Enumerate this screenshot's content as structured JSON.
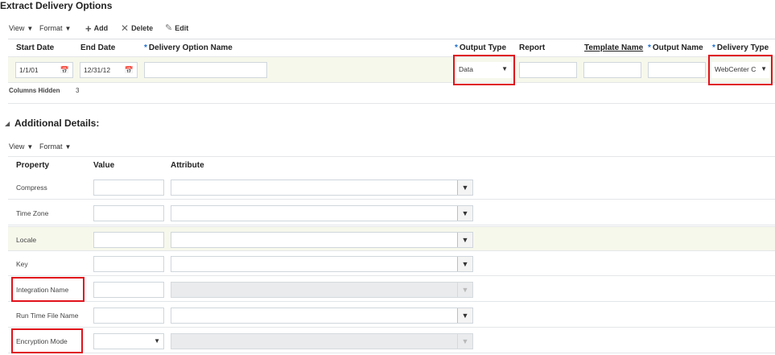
{
  "page_title": "Extract Delivery Options",
  "toolbar": {
    "view": "View",
    "format": "Format",
    "add": "Add",
    "delete": "Delete",
    "edit": "Edit"
  },
  "delivery_table": {
    "headers": {
      "start_date": "Start Date",
      "end_date": "End Date",
      "delivery_option_name": "Delivery Option Name",
      "output_type": "Output Type",
      "report": "Report",
      "template_name": "Template Name",
      "output_name": "Output Name",
      "delivery_type": "Delivery Type"
    },
    "row": {
      "start_date": "1/1/01",
      "end_date": "12/31/12",
      "delivery_option_name": "",
      "output_type": "Data",
      "report": "",
      "template_name": "",
      "output_name": "",
      "delivery_type": "WebCenter C"
    },
    "columns_hidden_label": "Columns Hidden",
    "columns_hidden_count": "3"
  },
  "additional_details": {
    "title": "Additional Details:",
    "toolbar": {
      "view": "View",
      "format": "Format"
    },
    "headers": {
      "property": "Property",
      "value": "Value",
      "attribute": "Attribute"
    },
    "rows": [
      {
        "property": "Compress",
        "value": "",
        "attribute": ""
      },
      {
        "property": "Time Zone",
        "value": "",
        "attribute": ""
      },
      {
        "property": "Locale",
        "value": "",
        "attribute": ""
      },
      {
        "property": "Key",
        "value": "",
        "attribute": ""
      },
      {
        "property": "Integration Name",
        "value": "",
        "attribute": ""
      },
      {
        "property": "Run Time File Name",
        "value": "",
        "attribute": ""
      },
      {
        "property": "Encryption Mode",
        "value": "",
        "attribute": ""
      }
    ]
  },
  "colors": {
    "highlight": "#e0121b",
    "selected_row": "#f7f8ec",
    "required": "#1a6ccf"
  },
  "icons": [
    "calendar-icon",
    "plus-icon",
    "delete-x-icon",
    "pencil-icon",
    "dropdown-arrow-icon",
    "collapse-triangle-icon"
  ]
}
